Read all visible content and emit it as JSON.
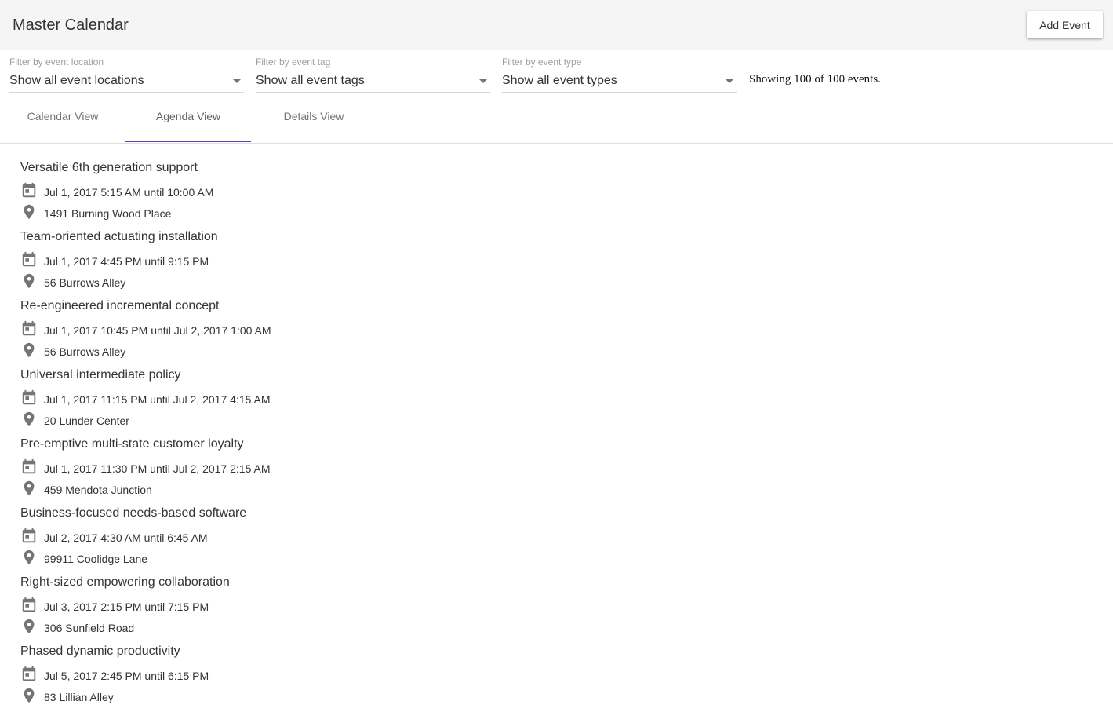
{
  "header": {
    "title": "Master Calendar",
    "add_event_label": "Add Event"
  },
  "filters": [
    {
      "label": "Filter by event location",
      "value": "Show all event locations"
    },
    {
      "label": "Filter by event tag",
      "value": "Show all event tags"
    },
    {
      "label": "Filter by event type",
      "value": "Show all event types"
    }
  ],
  "count_text": "Showing 100 of 100 events.",
  "tabs": [
    {
      "label": "Calendar View",
      "active": false
    },
    {
      "label": "Agenda View",
      "active": true
    },
    {
      "label": "Details View",
      "active": false
    }
  ],
  "colors": {
    "accent": "#673ab7",
    "icon": "#757575",
    "topbar": "#f5f5f5"
  },
  "icons": {
    "time": "calendar-icon",
    "location": "map-pin-icon"
  },
  "events": [
    {
      "title": "Versatile 6th generation support",
      "time": "Jul 1, 2017 5:15 AM until 10:00 AM",
      "location": "1491 Burning Wood Place"
    },
    {
      "title": "Team-oriented actuating installation",
      "time": "Jul 1, 2017 4:45 PM until 9:15 PM",
      "location": "56 Burrows Alley"
    },
    {
      "title": "Re-engineered incremental concept",
      "time": "Jul 1, 2017 10:45 PM until Jul 2, 2017 1:00 AM",
      "location": "56 Burrows Alley"
    },
    {
      "title": "Universal intermediate policy",
      "time": "Jul 1, 2017 11:15 PM until Jul 2, 2017 4:15 AM",
      "location": "20 Lunder Center"
    },
    {
      "title": "Pre-emptive multi-state customer loyalty",
      "time": "Jul 1, 2017 11:30 PM until Jul 2, 2017 2:15 AM",
      "location": "459 Mendota Junction"
    },
    {
      "title": "Business-focused needs-based software",
      "time": "Jul 2, 2017 4:30 AM until 6:45 AM",
      "location": "99911 Coolidge Lane"
    },
    {
      "title": "Right-sized empowering collaboration",
      "time": "Jul 3, 2017 2:15 PM until 7:15 PM",
      "location": "306 Sunfield Road"
    },
    {
      "title": "Phased dynamic productivity",
      "time": "Jul 5, 2017 2:45 PM until 6:15 PM",
      "location": "83 Lillian Alley"
    }
  ]
}
